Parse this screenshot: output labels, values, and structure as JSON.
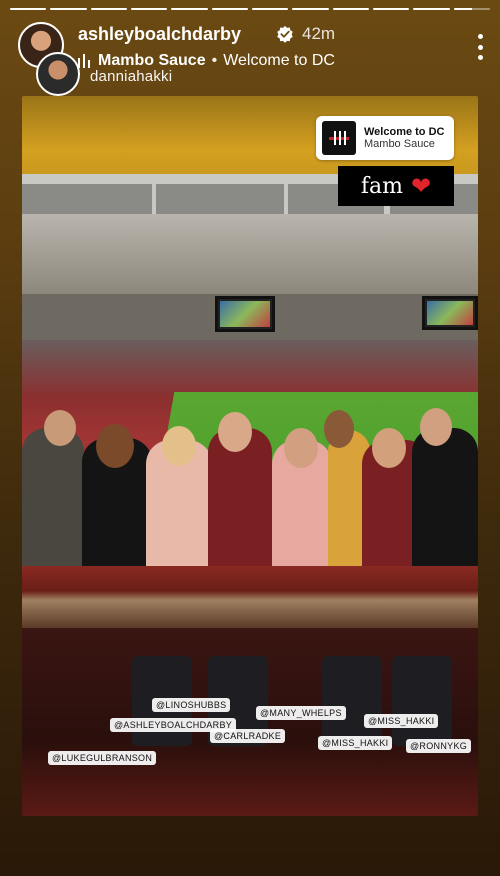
{
  "story": {
    "segments": 12,
    "current_segment": 12,
    "progress_fraction": 0.5
  },
  "header": {
    "username": "ashleyboalchdarby",
    "verified": true,
    "time_ago": "42m",
    "song": "Mambo Sauce",
    "separator": "•",
    "song_title": "Welcome to DC",
    "collab_username": "danniahakki"
  },
  "sticker": {
    "title": "Welcome to DC",
    "artist": "Mambo Sauce"
  },
  "caption": {
    "text": "fam",
    "emoji": "❤"
  },
  "photo_tags": [
    "@LINOSHUBBS",
    "@ASHLEYBOALCHDARBY",
    "@CARLRADKE",
    "@MANY_WHELPS",
    "@MISS_HAKKI",
    "@LUKEGULBRANSON",
    "@MISS_HAKKI",
    "@RONNYKG"
  ],
  "colors": {
    "accent_heart": "#e0242a",
    "verified": "#ffffff"
  }
}
